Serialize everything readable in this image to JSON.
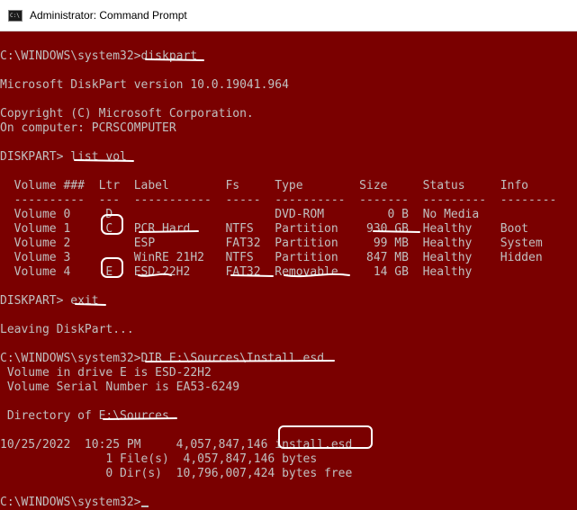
{
  "window": {
    "title": "Administrator: Command Prompt",
    "icon_name": "cmd-icon",
    "icon_text": "C:\\",
    "background": "#7a0000",
    "text_color": "#c0c0c0",
    "annotation_color": "#ffffff"
  },
  "console": {
    "lines": [
      "",
      "C:\\WINDOWS\\system32>diskpart",
      "",
      "Microsoft DiskPart version 10.0.19041.964",
      "",
      "Copyright (C) Microsoft Corporation.",
      "On computer: PCRSCOMPUTER",
      "",
      "DISKPART> list vol",
      "",
      "  Volume ###  Ltr  Label        Fs     Type        Size     Status     Info",
      "  ----------  ---  -----------  -----  ----------  -------  ---------  --------",
      "  Volume 0     D                       DVD-ROM         0 B  No Media",
      "  Volume 1     C   PCR Hard     NTFS   Partition    930 GB  Healthy    Boot",
      "  Volume 2         ESP          FAT32  Partition     99 MB  Healthy    System",
      "  Volume 3         WinRE 21H2   NTFS   Partition    847 MB  Healthy    Hidden",
      "  Volume 4     E   ESD-22H2     FAT32  Removable     14 GB  Healthy",
      "",
      "DISKPART> exit",
      "",
      "Leaving DiskPart...",
      "",
      "C:\\WINDOWS\\system32>DIR E:\\Sources\\Install.esd",
      " Volume in drive E is ESD-22H2",
      " Volume Serial Number is EA53-6249",
      "",
      " Directory of E:\\Sources",
      "",
      "10/25/2022  10:25 PM     4,057,847,146 install.esd",
      "               1 File(s)  4,057,847,146 bytes",
      "               0 Dir(s)  10,796,007,424 bytes free",
      "",
      "C:\\WINDOWS\\system32>"
    ]
  }
}
